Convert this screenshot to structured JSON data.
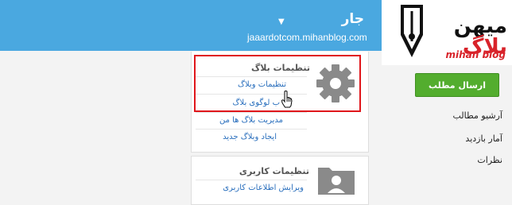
{
  "header": {
    "blog_title": "جار",
    "blog_url": "jaaardotcom.mihanblog.com"
  },
  "logo": {
    "text_black": "میهن",
    "text_red": "بلاگ",
    "text_en": "mihan blog"
  },
  "sidebar": {
    "send_button": "ارسال مطلب",
    "items": [
      {
        "label": "آرشیو مطالب"
      },
      {
        "label": "آمار بازدید"
      },
      {
        "label": "نظرات"
      }
    ]
  },
  "settings_panel": {
    "title": "تنظیمات بلاگ",
    "links": [
      {
        "label": "تنظیمات وبلاگ"
      },
      {
        "label": "ب لوگوی بلاگ"
      },
      {
        "label": "مدیریت بلاگ ها من"
      },
      {
        "label": "ایجاد وبلاگ جدید"
      }
    ]
  },
  "user_panel": {
    "title": "تنظیمات کاربری",
    "links": [
      {
        "label": "ویرایش اطلاعات کاربری"
      }
    ]
  },
  "colors": {
    "header": "#4aa8e0",
    "send_button": "#53ad2e",
    "link": "#2a6fbd",
    "highlight": "#e0161b"
  }
}
